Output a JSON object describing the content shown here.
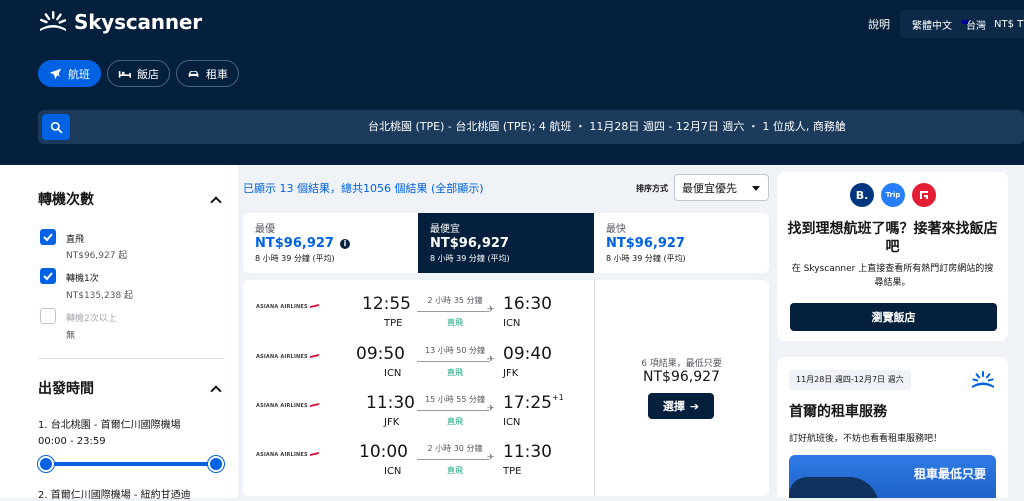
{
  "header": {
    "brand": "Skyscanner",
    "help": "說明",
    "locale": "繁體中文",
    "region": "台灣",
    "currency": "NT$ TWD",
    "nav": [
      {
        "label": "航班",
        "icon": "plane-icon",
        "active": true
      },
      {
        "label": "飯店",
        "icon": "bed-icon",
        "active": false
      },
      {
        "label": "租車",
        "icon": "car-icon",
        "active": false
      }
    ],
    "search_summary": "台北桃園 (TPE) - 台北桃園 (TPE); 4 航班 ・ 11月28日 週四 - 12月7日 週六 ・ 1 位成人, 商務艙"
  },
  "filters": {
    "stops": {
      "title": "轉機次數",
      "options": [
        {
          "label": "直飛",
          "price": "NT$96,927 起",
          "checked": true
        },
        {
          "label": "轉機1次",
          "price": "NT$135,238 起",
          "checked": true
        },
        {
          "label": "轉機2次以上",
          "price": "無",
          "checked": false
        }
      ]
    },
    "departure": {
      "title": "出發時間",
      "routes": [
        {
          "label": "1. 台北桃園 - 首爾仁川國際機場",
          "range": "00:00 - 23:59"
        },
        {
          "label": "2. 首爾仁川國際機場 - 紐約甘迺迪"
        }
      ]
    }
  },
  "results": {
    "info": "已顯示 13 個結果，總共1056 個結果 (全部顯示)",
    "sort_label": "排序方式",
    "sort_value": "最便宜優先",
    "tabs": [
      {
        "title": "最優",
        "price": "NT$96,927",
        "sub": "8 小時 39 分鐘 (平均)",
        "selected": false
      },
      {
        "title": "最便宜",
        "price": "NT$96,927",
        "sub": "8 小時 39 分鐘 (平均)",
        "selected": true
      },
      {
        "title": "最快",
        "price": "NT$96,927",
        "sub": "8 小時 39 分鐘 (平均)",
        "selected": false
      }
    ],
    "itinerary": {
      "legs": [
        {
          "airline": "ASIANA AIRLINES",
          "dep_time": "12:55",
          "dep_code": "TPE",
          "duration": "2 小時 35 分鐘",
          "stops": "直飛",
          "arr_time": "16:30",
          "arr_code": "ICN",
          "plus": ""
        },
        {
          "airline": "ASIANA AIRLINES",
          "dep_time": "09:50",
          "dep_code": "ICN",
          "duration": "13 小時 50 分鐘",
          "stops": "直飛",
          "arr_time": "09:40",
          "arr_code": "JFK",
          "plus": ""
        },
        {
          "airline": "ASIANA AIRLINES",
          "dep_time": "11:30",
          "dep_code": "JFK",
          "duration": "15 小時 55 分鐘",
          "stops": "直飛",
          "arr_time": "17:25",
          "arr_code": "ICN",
          "plus": "+1"
        },
        {
          "airline": "ASIANA AIRLINES",
          "dep_time": "10:00",
          "dep_code": "ICN",
          "duration": "2 小時 30 分鐘",
          "stops": "直飛",
          "arr_time": "11:30",
          "arr_code": "TPE",
          "plus": ""
        }
      ],
      "deal_count": "6 項結果，最低只要",
      "price": "NT$96,927",
      "select_label": "選擇"
    }
  },
  "ads": {
    "hotel": {
      "logos": [
        "B.",
        "Trip"
      ],
      "title": "找到理想航班了嗎？接著來找飯店吧",
      "text": "在 Skyscanner 上直接查看所有熱門訂房網站的搜尋結果。",
      "button": "瀏覽飯店"
    },
    "car": {
      "dates": "11月28日 週四-12月7日 週六",
      "title": "首爾的租車服務",
      "text": "訂好航班後，不妨也看看租車服務吧！",
      "promo": "租車最低只要"
    }
  },
  "colors": {
    "navy": "#05203c",
    "blue": "#0062e3",
    "green": "#0fa57a"
  }
}
